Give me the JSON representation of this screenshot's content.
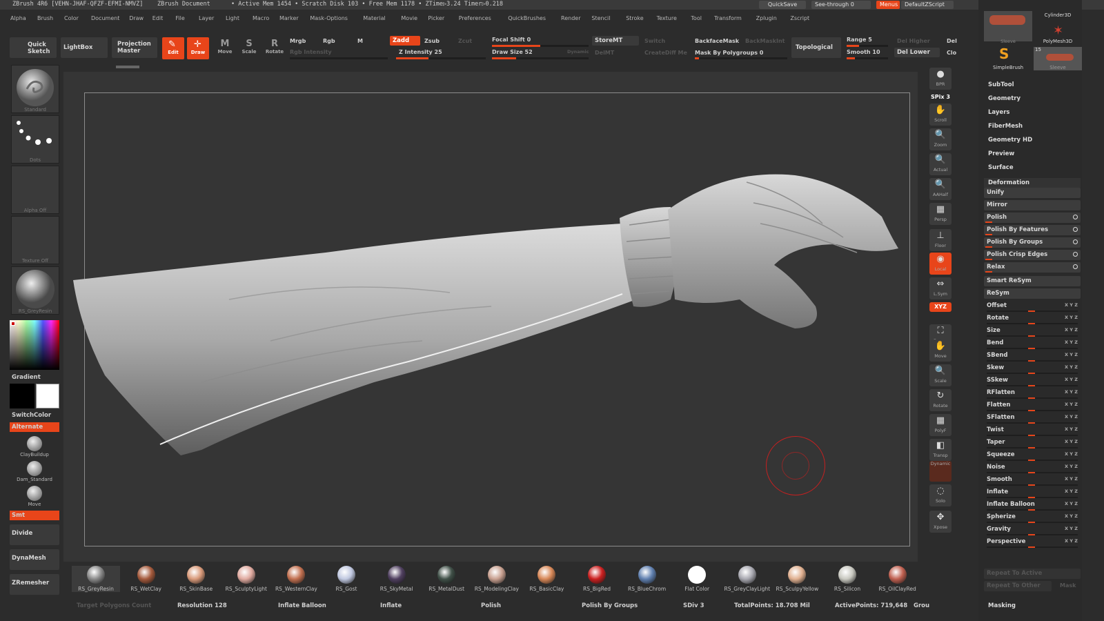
{
  "titlebar": {
    "app": "ZBrush 4R6 [VEHN-JHAF-QFZF-EFMI-NMVZ]",
    "doc": "ZBrush Document",
    "active_mem": "• Active Mem 1454 • Scratch Disk 103 • Free Mem 1178 • ZTime▷3.24 Timer▷0.218",
    "quicksave": "QuickSave",
    "see_through": "See-through  0",
    "menus": "Menus",
    "script": "DefaultZScript"
  },
  "menu": [
    "Alpha",
    "Brush",
    "Color",
    "Document",
    "Draw",
    "Edit",
    "File",
    "Layer",
    "Light",
    "Macro",
    "Marker",
    "Mask-Options",
    "Material",
    "Movie",
    "Picker",
    "Preferences",
    "QuickBrushes",
    "Render",
    "Stencil",
    "Stroke",
    "Texture",
    "Tool",
    "Transform",
    "Zplugin",
    "Zscript"
  ],
  "toolbar": {
    "quick_sketch": "Quick Sketch",
    "lightbox": "LightBox",
    "projection_master": "Projection Master",
    "edit": "Edit",
    "draw": "Draw",
    "move": "Move",
    "scale": "Scale",
    "rotate": "Rotate",
    "mrgb": "Mrgb",
    "rgb": "Rgb",
    "m": "M",
    "rgb_intensity": "Rgb Intensity",
    "zadd": "Zadd",
    "zsub": "Zsub",
    "zcut": "Zcut",
    "z_intensity": "Z Intensity 25",
    "focal_shift": "Focal Shift 0",
    "draw_size": "Draw Size 52",
    "dynamic": "Dynamic",
    "storemt": "StoreMT",
    "switch": "Switch",
    "delmt": "DelMT",
    "creatediff": "CreateDiff Me",
    "backfacemask": "BackfaceMask",
    "backmaskint": "BackMaskInt",
    "mask_by_polygroups": "Mask By Polygroups 0",
    "topological": "Topological",
    "range": "Range 5",
    "smooth": "Smooth 10",
    "del_higher": "Del Higher",
    "del_lower": "Del Lower",
    "del": "Del",
    "clo": "Clo",
    "z_intensity_value": 0.36,
    "focal_shift_value": 0.5,
    "draw_size_value": 0.25,
    "range_value": 0.3,
    "smooth_value": 0.2
  },
  "left": {
    "brush": "Standard",
    "stroke": "Dots",
    "alpha": "Alpha Off",
    "texture": "Texture Off",
    "material": "RS_GreyResin",
    "gradient": "Gradient",
    "switchcolor": "SwitchColor",
    "alternate": "Alternate",
    "quick_brushes": [
      "ClayBuildup",
      "Dam_Standard",
      "Move"
    ],
    "smt": "Smt",
    "divide": "Divide",
    "dynamesh": "DynaMesh",
    "zremesher": "ZRemesher"
  },
  "rightshelf": [
    {
      "label": "BPR",
      "icon": "●"
    },
    {
      "label": "SPix 3",
      "icon": ""
    },
    {
      "label": "Scroll",
      "icon": "✋"
    },
    {
      "label": "Zoom",
      "icon": "🔍"
    },
    {
      "label": "Actual",
      "icon": "🔍"
    },
    {
      "label": "AAHalf",
      "icon": "🔍"
    },
    {
      "label": "Persp",
      "icon": "▦"
    },
    {
      "label": "Floor",
      "icon": "⊥"
    },
    {
      "label": "Local",
      "icon": "◉"
    },
    {
      "label": "L.Sym",
      "icon": "⇔"
    },
    {
      "label": "XYZ",
      "icon": ""
    },
    {
      "label": "Frame",
      "icon": "⛶"
    },
    {
      "label": "Move",
      "icon": "✋"
    },
    {
      "label": "Scale",
      "icon": "🔍"
    },
    {
      "label": "Rotate",
      "icon": "↻"
    },
    {
      "label": "PolyF",
      "icon": "▦"
    },
    {
      "label": "Transp",
      "icon": "◧"
    },
    {
      "label": "Dynamic",
      "icon": ""
    },
    {
      "label": "Solo",
      "icon": "◌"
    },
    {
      "label": "Xpose",
      "icon": "✥"
    }
  ],
  "rpanel": {
    "tool_items": [
      "Sleeve",
      "Cylinder3D",
      "PolyMesh3D",
      "SimpleBrush",
      "Sleeve"
    ],
    "tool_count": "15",
    "headers": [
      "SubTool",
      "Geometry",
      "Layers",
      "FiberMesh",
      "Geometry HD",
      "Preview",
      "Surface",
      "Deformation"
    ],
    "deform": [
      "Unify",
      "Mirror",
      "Polish",
      "Polish By Features",
      "Polish By Groups",
      "Polish Crisp Edges",
      "Relax",
      "Smart ReSym",
      "ReSym",
      "Offset",
      "Rotate",
      "Size",
      "Bend",
      "SBend",
      "Skew",
      "SSkew",
      "RFlatten",
      "Flatten",
      "SFlatten",
      "Twist",
      "Taper",
      "Squeeze",
      "Noise",
      "Smooth",
      "Inflate",
      "Inflate Balloon",
      "Spherize",
      "Gravity",
      "Perspective"
    ],
    "repeat_active": "Repeat To Active",
    "repeat_other": "Repeat To Other",
    "mask": "Mask",
    "masking": "Masking",
    "xyz": "X Y Z"
  },
  "materials": [
    {
      "name": "RS_GreyResin",
      "color": "#8a8a8a"
    },
    {
      "name": "RS_WetClay",
      "color": "#a55a3c"
    },
    {
      "name": "RS_SkinBase",
      "color": "#d99a7a"
    },
    {
      "name": "RS_SculptyLight",
      "color": "#e0aaa0"
    },
    {
      "name": "RS_WesternClay",
      "color": "#c27050"
    },
    {
      "name": "RS_Gost",
      "color": "#c0c8e0"
    },
    {
      "name": "RS_SkyMetal",
      "color": "#504060"
    },
    {
      "name": "RS_MetalDust",
      "color": "#405048"
    },
    {
      "name": "RS_ModelingClay",
      "color": "#c8a090"
    },
    {
      "name": "RS_BasicClay",
      "color": "#d88858"
    },
    {
      "name": "RS_BigRed",
      "color": "#cc2020"
    },
    {
      "name": "RS_BlueChrom",
      "color": "#6080b0"
    },
    {
      "name": "Flat Color",
      "color": "#ffffff"
    },
    {
      "name": "RS_GreyClayLight",
      "color": "#a8a8b0"
    },
    {
      "name": "RS_SculpyYellow",
      "color": "#e0b090"
    },
    {
      "name": "RS_Silicon",
      "color": "#c8c8c0"
    },
    {
      "name": "RS_OilClayRed",
      "color": "#c06050"
    }
  ],
  "status": {
    "target": "Target Polygons Count",
    "resolution": "Resolution 128",
    "inflate_balloon": "Inflate Balloon",
    "inflate": "Inflate",
    "polish": "Polish",
    "polish_groups": "Polish By Groups",
    "sdiv": "SDiv 3",
    "total": "TotalPoints: 18.708 Mil",
    "active": "ActivePoints: 719,648",
    "grou": "Grou"
  },
  "colors": {
    "accent": "#e8451a",
    "panel": "#3a3a3a"
  }
}
